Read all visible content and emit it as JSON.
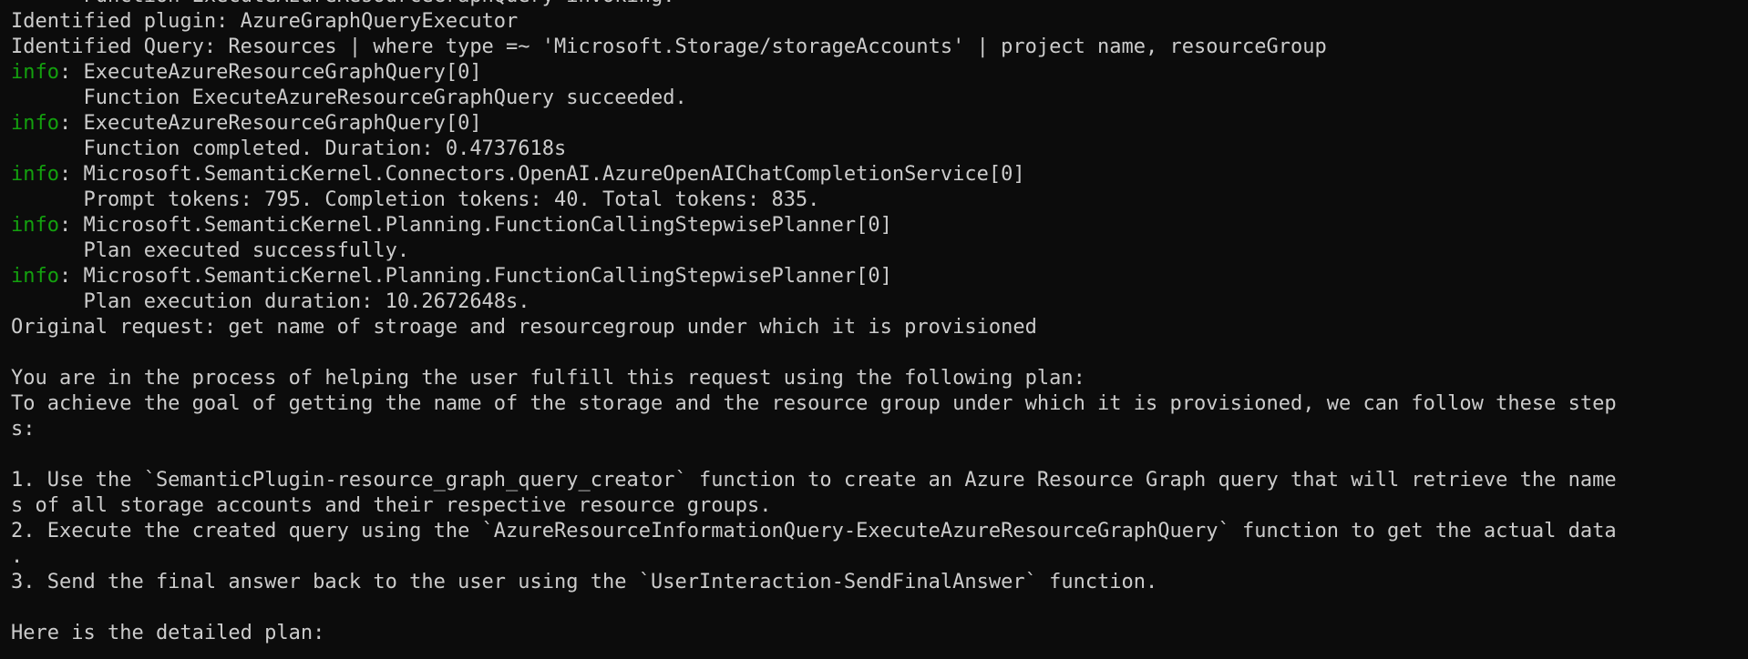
{
  "terminal": {
    "lines": [
      {
        "text": "      Function ExecuteAzureResourceGraphQuery invoking."
      },
      {
        "text": "Identified plugin: AzureGraphQueryExecutor"
      },
      {
        "text": "Identified Query: Resources | where type =~ 'Microsoft.Storage/storageAccounts' | project name, resourceGroup"
      },
      {
        "prefix": "info",
        "text": ": ExecuteAzureResourceGraphQuery[0]"
      },
      {
        "text": "      Function ExecuteAzureResourceGraphQuery succeeded."
      },
      {
        "prefix": "info",
        "text": ": ExecuteAzureResourceGraphQuery[0]"
      },
      {
        "text": "      Function completed. Duration: 0.4737618s"
      },
      {
        "prefix": "info",
        "text": ": Microsoft.SemanticKernel.Connectors.OpenAI.AzureOpenAIChatCompletionService[0]"
      },
      {
        "text": "      Prompt tokens: 795. Completion tokens: 40. Total tokens: 835."
      },
      {
        "prefix": "info",
        "text": ": Microsoft.SemanticKernel.Planning.FunctionCallingStepwisePlanner[0]"
      },
      {
        "text": "      Plan executed successfully."
      },
      {
        "prefix": "info",
        "text": ": Microsoft.SemanticKernel.Planning.FunctionCallingStepwisePlanner[0]"
      },
      {
        "text": "      Plan execution duration: 10.2672648s."
      },
      {
        "text": "Original request: get name of stroage and resourcegroup under which it is provisioned"
      },
      {
        "text": ""
      },
      {
        "text": "You are in the process of helping the user fulfill this request using the following plan:"
      },
      {
        "text": "To achieve the goal of getting the name of the storage and the resource group under which it is provisioned, we can follow these step"
      },
      {
        "text": "s:"
      },
      {
        "text": ""
      },
      {
        "text": "1. Use the `SemanticPlugin-resource_graph_query_creator` function to create an Azure Resource Graph query that will retrieve the name"
      },
      {
        "text": "s of all storage accounts and their respective resource groups."
      },
      {
        "text": "2. Execute the created query using the `AzureResourceInformationQuery-ExecuteAzureResourceGraphQuery` function to get the actual data"
      },
      {
        "text": "."
      },
      {
        "text": "3. Send the final answer back to the user using the `UserInteraction-SendFinalAnswer` function."
      },
      {
        "text": ""
      },
      {
        "text": "Here is the detailed plan:"
      }
    ]
  },
  "colors": {
    "background": "#0c0c0c",
    "foreground": "#cccccc",
    "info": "#13a10e"
  }
}
